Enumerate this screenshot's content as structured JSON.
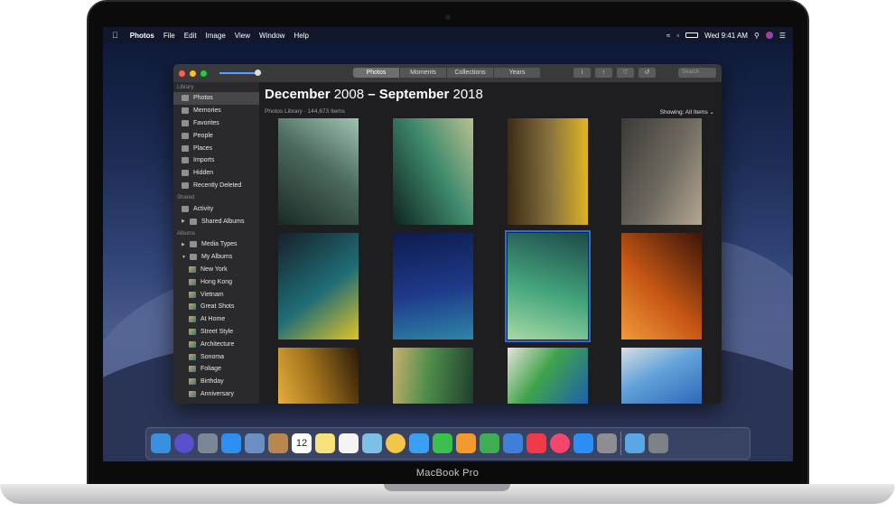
{
  "menubar": {
    "app_name": "Photos",
    "menus": [
      "File",
      "Edit",
      "Image",
      "View",
      "Window",
      "Help"
    ],
    "clock": "Wed 9:41 AM"
  },
  "window": {
    "tabs": [
      "Photos",
      "Moments",
      "Collections",
      "Years"
    ],
    "active_tab": "Photos",
    "search_placeholder": "Search",
    "title_bold_1": "December",
    "title_year_1": "2008",
    "title_dash": "–",
    "title_bold_2": "September",
    "title_year_2": "2018",
    "subtitle": "Photos Library · 144,673 Items",
    "showing_label": "Showing: All Items"
  },
  "sidebar": {
    "library_heading": "Library",
    "library_items": [
      "Photos",
      "Memories",
      "Favorites",
      "People",
      "Places",
      "Imports",
      "Hidden",
      "Recently Deleted"
    ],
    "shared_heading": "Shared",
    "shared_items": [
      "Activity",
      "Shared Albums"
    ],
    "albums_heading": "Albums",
    "albums_items": [
      "Media Types",
      "My Albums"
    ],
    "my_albums": [
      "New York",
      "Hong Kong",
      "Vietnam",
      "Great Shots",
      "At Home",
      "Street Style",
      "Architecture",
      "Sonoma",
      "Foliage",
      "Birthday",
      "Anniversary"
    ]
  },
  "photos": {
    "count": 12,
    "selected_index": 6,
    "palettes": [
      [
        "#1a2a25",
        "#4c6a5d",
        "#9fc3b3"
      ],
      [
        "#0f2320",
        "#3f8b6d",
        "#b8c08f"
      ],
      [
        "#3a2a15",
        "#8a7440",
        "#e2b621"
      ],
      [
        "#3b3a35",
        "#6f6a60",
        "#b3a790"
      ],
      [
        "#17212a",
        "#1f6d76",
        "#e0c425"
      ],
      [
        "#0d1c4f",
        "#1e3a8a",
        "#2d86a8"
      ],
      [
        "#1d4a4a",
        "#44a57c",
        "#a6d9a5"
      ],
      [
        "#3d1508",
        "#c55614",
        "#f19a3b"
      ],
      [
        "#2b1a08",
        "#a1721c",
        "#e5ad3c"
      ],
      [
        "#1f3d2e",
        "#4f8c4a",
        "#c7b16e"
      ],
      [
        "#1f5fae",
        "#3fa34b",
        "#e6e2d8"
      ],
      [
        "#2f68b8",
        "#62a2da",
        "#d8dde2"
      ]
    ]
  },
  "dock": {
    "apps": [
      "Finder",
      "Siri",
      "Launchpad",
      "Safari",
      "Mail",
      "Contacts",
      "Calendar",
      "Notes",
      "Reminders",
      "Maps",
      "Photos",
      "Messages",
      "FaceTime",
      "Pages",
      "Numbers",
      "Keynote",
      "News",
      "Music",
      "App Store",
      "System Preferences"
    ],
    "calendar_day": "12"
  },
  "device_label": "MacBook Pro"
}
